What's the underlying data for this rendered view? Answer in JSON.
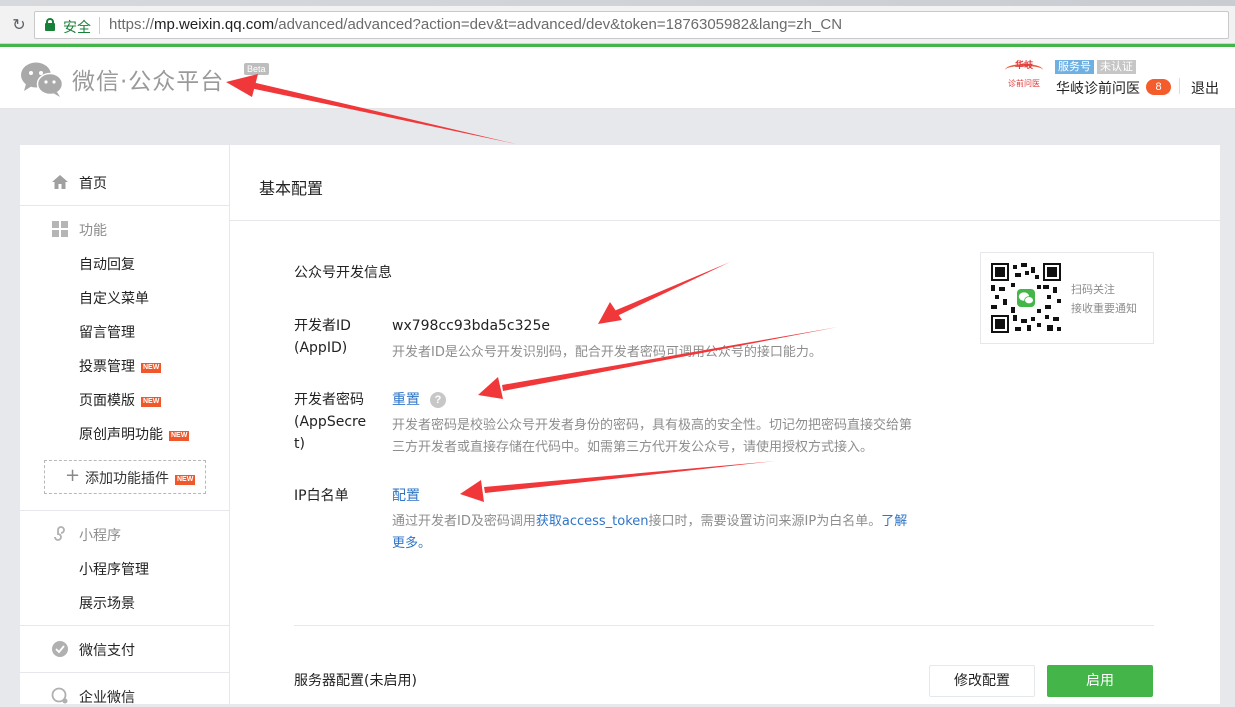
{
  "browser": {
    "secure_label": "安全",
    "url_scheme": "https://",
    "url_host": "mp.weixin.qq.com",
    "url_path": "/advanced/advanced?action=dev&t=advanced/dev&token=1876305982&lang=zh_CN"
  },
  "header": {
    "brand": "微信·公众平台",
    "beta": "Beta",
    "account_logo_top": "华岐",
    "account_logo_bottom": "诊前问医",
    "service_tag": "服务号",
    "unverified_tag": "未认证",
    "account_name": "华岐诊前问医",
    "notification_count": "8",
    "logout": "退出"
  },
  "sidebar": {
    "home": "首页",
    "features_title": "功能",
    "features": [
      {
        "label": "自动回复",
        "new": false
      },
      {
        "label": "自定义菜单",
        "new": false
      },
      {
        "label": "留言管理",
        "new": false
      },
      {
        "label": "投票管理",
        "new": true
      },
      {
        "label": "页面模版",
        "new": true
      },
      {
        "label": "原创声明功能",
        "new": true
      }
    ],
    "new_tag": "NEW",
    "add_plugin": "添加功能插件",
    "miniprogram_title": "小程序",
    "miniprogram": [
      {
        "label": "小程序管理"
      },
      {
        "label": "展示场景"
      }
    ],
    "wechat_pay": "微信支付",
    "wecom": "企业微信"
  },
  "main": {
    "title": "基本配置",
    "section_title": "公众号开发信息",
    "appid_label_1": "开发者ID",
    "appid_label_2": "(AppID)",
    "appid_value": "wx798cc93bda5c325e",
    "appid_desc": "开发者ID是公众号开发识别码，配合开发者密码可调用公众号的接口能力。",
    "secret_label_1": "开发者密码",
    "secret_label_2": "(AppSecre",
    "secret_label_3": "t)",
    "secret_reset": "重置",
    "secret_help": "?",
    "secret_desc_1": "开发者密码是校验公众号开发者身份的密码，具有极高的安全性。切记勿把密码直接交给第",
    "secret_desc_2": "三方开发者或直接存储在代码中。如需第三方代开发公众号，请使用授权方式接入。",
    "ip_label": "IP白名单",
    "ip_config": "配置",
    "ip_desc_1_pre": "通过开发者ID及密码调用",
    "ip_desc_1_link": "获取access_token",
    "ip_desc_1_post": "接口时，需要设置访问来源IP为白名单。",
    "ip_desc_learn_1": "了解",
    "ip_desc_learn_2": "更多",
    "ip_desc_end": "。",
    "qr_text_1": "扫码关注",
    "qr_text_2": "接收重要通知",
    "server_title": "服务器配置(未启用)",
    "btn_modify": "修改配置",
    "btn_enable": "启用"
  },
  "colors": {
    "brand_green": "#44b549",
    "link_blue": "#2e74c7",
    "arrow_red": "#f0383b"
  },
  "icons": [
    "reload-icon",
    "lock-icon",
    "wechat-logo-icon",
    "home-icon",
    "grid-icon",
    "plus-icon",
    "miniprogram-icon",
    "wechat-pay-icon",
    "wecom-icon",
    "help-icon",
    "qr-code"
  ]
}
